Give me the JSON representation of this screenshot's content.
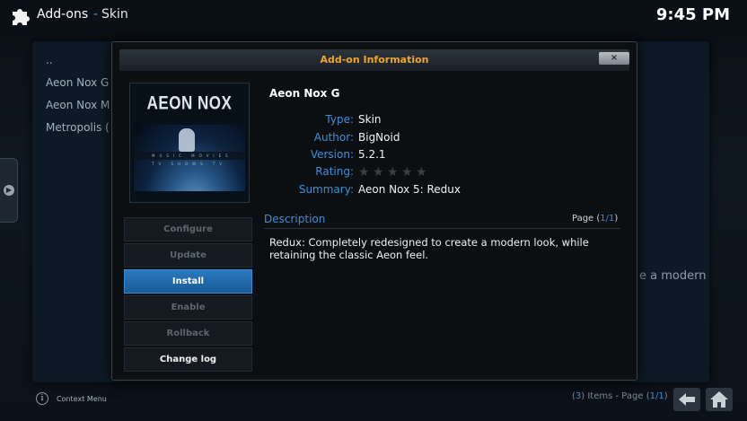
{
  "header": {
    "title": "Add-ons",
    "separator": "-",
    "subtitle": "Skin",
    "clock": "9:45 PM"
  },
  "background_list": {
    "items": [
      "..",
      "Aeon Nox G",
      "Aeon Nox M",
      "Metropolis ("
    ],
    "desc_fragment": "e a modern"
  },
  "footer": {
    "context_menu": "Context Menu",
    "items_prefix": "(",
    "items_count": "3",
    "items_mid": ") Items - Page (",
    "items_page": "1/1",
    "items_suffix": ")"
  },
  "dialog": {
    "title": "Add-on Information",
    "close_label": "×",
    "thumbnail": {
      "title": "AEON NOX",
      "menu_strip": "MUSIC MOVIES TV SHOWS TV"
    },
    "addon_name": "Aeon Nox G",
    "fields": {
      "type_label": "Type:",
      "type_value": "Skin",
      "author_label": "Author:",
      "author_value": "BigNoid",
      "version_label": "Version:",
      "version_value": "5.2.1",
      "rating_label": "Rating:",
      "rating_value": 0,
      "summary_label": "Summary:",
      "summary_value": "Aeon Nox 5: Redux"
    },
    "buttons": {
      "configure": "Configure",
      "update": "Update",
      "install": "Install",
      "enable": "Enable",
      "rollback": "Rollback",
      "changelog": "Change log"
    },
    "description": {
      "label": "Description",
      "page_prefix": "Page (",
      "page_value": "1/1",
      "page_suffix": ")",
      "text": "Redux: Completely redesigned to create a modern look, while retaining the classic Aeon feel."
    }
  },
  "colors": {
    "accent_blue": "#3f90d8",
    "title_orange": "#f0a52a",
    "selected_button": "#2b78bf"
  },
  "icons": [
    "puzzle-icon",
    "info-icon",
    "back-arrow-icon",
    "home-icon",
    "close-icon",
    "side-menu-icon"
  ]
}
